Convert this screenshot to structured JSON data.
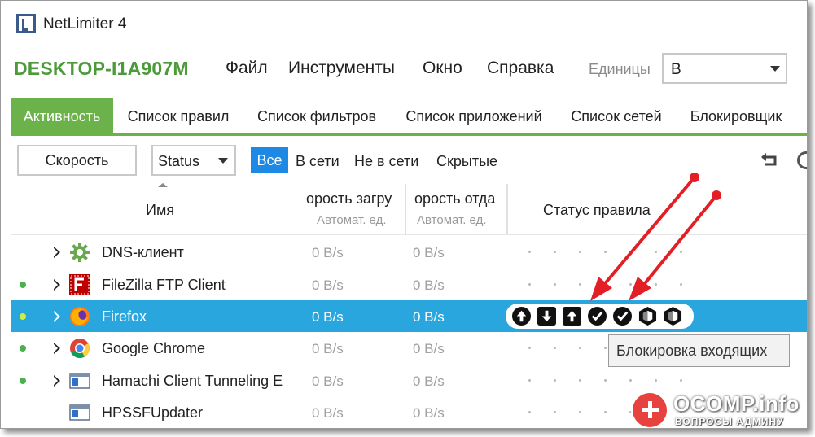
{
  "window": {
    "title": "NetLimiter 4"
  },
  "menubar": {
    "host": "DESKTOP-I1A907M",
    "items": [
      "Файл",
      "Инструменты",
      "Окно",
      "Справка"
    ],
    "units_label": "Единицы",
    "units_value": "B"
  },
  "tabs": [
    "Активность",
    "Список правил",
    "Список фильтров",
    "Список приложений",
    "Список сетей",
    "Блокировщик"
  ],
  "active_tab": "Активность",
  "toolbar": {
    "speed_button": "Скорость",
    "status_select": "Status",
    "filters": [
      "Все",
      "В сети",
      "Не в сети",
      "Скрытые"
    ],
    "active_filter": "Все"
  },
  "columns": {
    "name": "Имя",
    "download": "орость загру",
    "download_sub": "Автомат. ед.",
    "upload": "орость отда",
    "upload_sub": "Автомат. ед.",
    "status": "Статус правила"
  },
  "rows": [
    {
      "name": "DNS-клиент",
      "download": "0 B/s",
      "upload": "0 B/s",
      "online": false,
      "icon": "gear-icon",
      "expandable": true
    },
    {
      "name": "FileZilla FTP Client",
      "download": "0 B/s",
      "upload": "0 B/s",
      "online": true,
      "icon": "filezilla-icon",
      "expandable": true
    },
    {
      "name": "Firefox",
      "download": "0 B/s",
      "upload": "0 B/s",
      "online": true,
      "icon": "firefox-icon",
      "expandable": true,
      "selected": true
    },
    {
      "name": "Google Chrome",
      "download": "0 B/s",
      "upload": "0 B/s",
      "online": true,
      "icon": "chrome-icon",
      "expandable": true
    },
    {
      "name": "Hamachi Client Tunneling E",
      "download": "0 B/s",
      "upload": "0 B/s",
      "online": true,
      "icon": "window-icon",
      "expandable": true
    },
    {
      "name": "HPSSFUpdater",
      "download": "0 B/s",
      "upload": "0 B/s",
      "online": false,
      "icon": "window-icon",
      "expandable": false
    }
  ],
  "rule_status_icons": [
    "arrow-up-icon",
    "arrow-down-icon",
    "arrow-up-icon",
    "check-icon",
    "check-icon",
    "shield-half-icon",
    "shield-half-icon"
  ],
  "tooltip": "Блокировка входящих",
  "annotation_color": "#e31e24",
  "accent_green": "#6cb24a",
  "selection_blue": "#2aa6df",
  "watermark": {
    "main": "OCOMP.info",
    "sub": "ВОПРОСЫ АДМИНУ"
  }
}
